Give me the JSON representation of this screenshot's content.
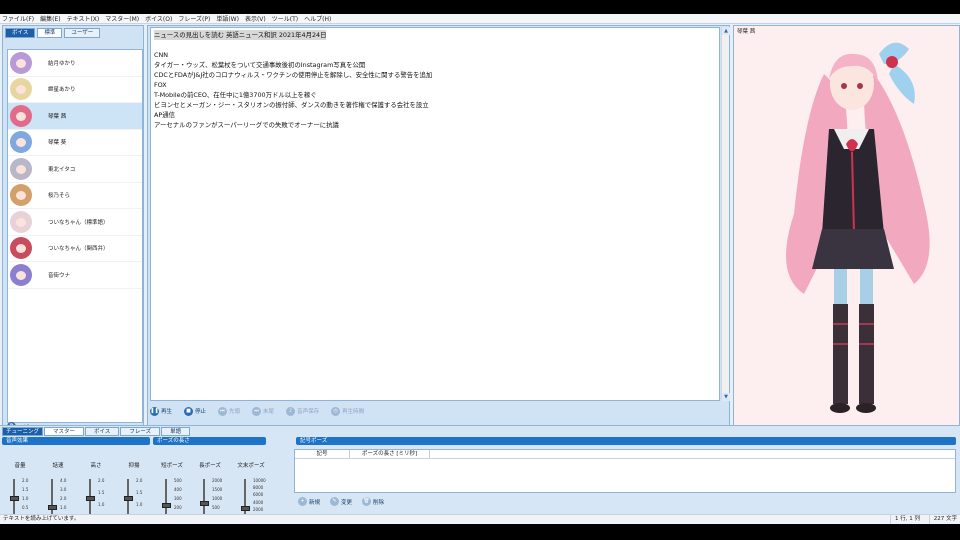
{
  "menu": [
    "ファイル(F)",
    "編集(E)",
    "テキスト(X)",
    "マスター(M)",
    "ボイス(O)",
    "フレーズ(P)",
    "単語(W)",
    "表示(V)",
    "ツール(T)",
    "ヘルプ(H)"
  ],
  "voice_panel": {
    "tab_voice": "ボイス",
    "tab_standard": "標準",
    "tab_user": "ユーザー",
    "voices": [
      {
        "name": "結月ゆかり",
        "color": "#b99ad8"
      },
      {
        "name": "紲星あかり",
        "color": "#e8d6a0"
      },
      {
        "name": "琴葉 茜",
        "color": "#e36b8a"
      },
      {
        "name": "琴葉 葵",
        "color": "#7fa7e0"
      },
      {
        "name": "東北イタコ",
        "color": "#b7b7c8"
      },
      {
        "name": "桜乃そら",
        "color": "#d3a06a"
      },
      {
        "name": "ついなちゃん（標準語）",
        "color": "#e7d2d8"
      },
      {
        "name": "ついなちゃん（関西弁）",
        "color": "#c84c5c"
      },
      {
        "name": "音街ウナ",
        "color": "#8c7fd0"
      }
    ],
    "selected_index": 2,
    "copy_label": "コピー"
  },
  "editor": {
    "lines": [
      "ニュースの見出しを読む 英語ニュース和訳 2021年4月24日",
      "",
      "CNN",
      "タイガー・ウッズ、松葉杖をついて交通事故後初のInstagram写真を公開",
      "CDCとFDAがJ&J社のコロナウィルス・ワクチンの使用停止を解除し、安全性に関する警告を追加",
      "FOX",
      "T-Mobileの前CEO、在任中に1億3700万ドル以上を稼ぐ",
      "ビヨンセとメーガン・ジー・スタリオンの振付師、ダンスの動きを著作権で保護する会社を設立",
      "AP通信",
      "アーセナルのファンがスーパーリーグでの失敗でオーナーに抗議"
    ],
    "buttons": {
      "play": "再生",
      "stop": "停止",
      "head": "先頭",
      "tail": "末尾",
      "save_audio": "音声保存",
      "play_time": "再生時間"
    }
  },
  "character": {
    "label": "琴葉 茜"
  },
  "tuning": {
    "tab_label": "チューニング",
    "tabs": [
      "マスター",
      "ボイス",
      "フレーズ",
      "単語"
    ],
    "voice_effects_title": "音声効果",
    "pause_length_title": "ポーズの長さ",
    "sliders": [
      {
        "label": "音量",
        "ticks": [
          "2.0",
          "1.5",
          "1.0",
          "0.5",
          "0.0"
        ],
        "value": 0.5
      },
      {
        "label": "話速",
        "ticks": [
          "4.0",
          "3.0",
          "2.0",
          "1.0",
          "0.5"
        ],
        "value": 0.25
      },
      {
        "label": "高さ",
        "ticks": [
          "2.0",
          "1.5",
          "1.0",
          "0.5"
        ],
        "value": 0.5
      },
      {
        "label": "抑揚",
        "ticks": [
          "2.0",
          "1.5",
          "1.0",
          "0.5"
        ],
        "value": 0.5
      },
      {
        "label": "短ポーズ",
        "ticks": [
          "500",
          "400",
          "300",
          "200",
          "100"
        ],
        "value": 0.3
      },
      {
        "label": "長ポーズ",
        "ticks": [
          "2000",
          "1500",
          "1000",
          "500",
          "80"
        ],
        "value": 0.35
      },
      {
        "label": "文末ポーズ",
        "ticks": [
          "10000",
          "8000",
          "6000",
          "4000",
          "2000",
          "0"
        ],
        "value": 0.2
      }
    ],
    "symbol_pause_title": "記号ポーズ",
    "symbol_col": "記号",
    "pause_len_col": "ポーズの長さ [ミリ秒]",
    "btn_new": "新規",
    "btn_edit": "変更",
    "btn_delete": "削除"
  },
  "status": {
    "message": "テキストを読み上げています。",
    "position": "1 行, 1 列",
    "chars": "227 文字"
  }
}
